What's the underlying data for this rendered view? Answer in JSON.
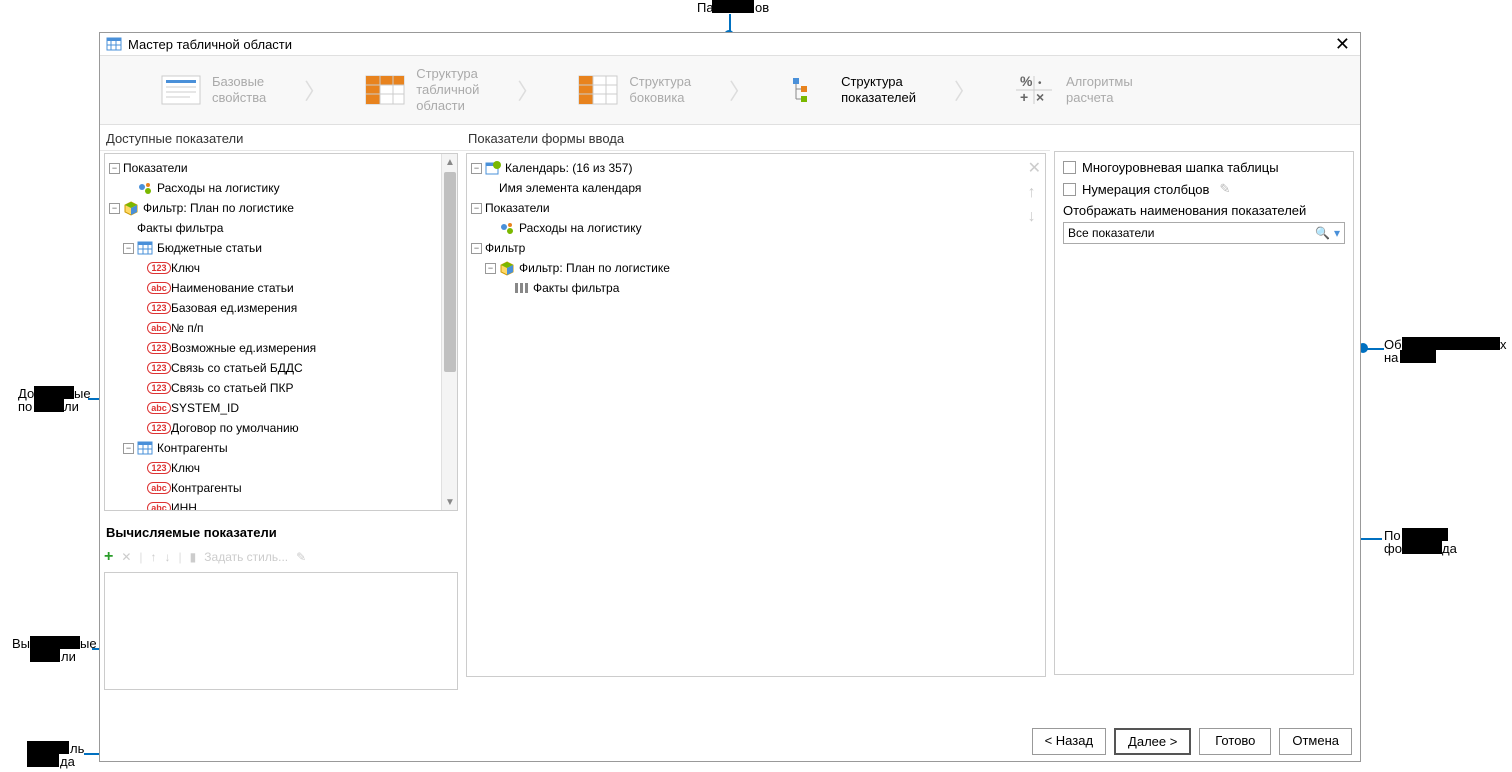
{
  "callouts": {
    "top": "Панель этапов",
    "left_avail": "Доступные\nпоказатели",
    "left_calc": "Вычисляемые\nпоказатели",
    "bottom_wizard": "Панель\nвизарда",
    "right_names": "Область общих\nнастроек",
    "right_form": "Показатели\nформы ввода"
  },
  "dialog": {
    "title": "Мастер табличной области"
  },
  "steps": [
    {
      "l1": "Базовые",
      "l2": "свойства"
    },
    {
      "l1": "Структура",
      "l2": "табличной",
      "l3": "области"
    },
    {
      "l1": "Структура",
      "l2": "боковика"
    },
    {
      "l1": "Структура",
      "l2": "показателей"
    },
    {
      "l1": "Алгоритмы",
      "l2": "расчета"
    }
  ],
  "left": {
    "header": "Доступные показатели",
    "tree": [
      {
        "lvl": 0,
        "toggle": "−",
        "icon": "none",
        "label": "Показатели"
      },
      {
        "lvl": 1,
        "toggle": "",
        "icon": "rec",
        "label": "Расходы на логистику"
      },
      {
        "lvl": 0,
        "toggle": "−",
        "icon": "cube",
        "label": "Фильтр: План по логистике"
      },
      {
        "lvl": 1,
        "toggle": "",
        "icon": "none",
        "label": "Факты фильтра"
      },
      {
        "lvl": 1,
        "toggle": "−",
        "icon": "grid",
        "label": "Бюджетные статьи"
      },
      {
        "lvl": 2,
        "toggle": "",
        "icon": "123",
        "label": "Ключ"
      },
      {
        "lvl": 2,
        "toggle": "",
        "icon": "abc",
        "label": "Наименование статьи"
      },
      {
        "lvl": 2,
        "toggle": "",
        "icon": "123",
        "label": "Базовая ед.измерения"
      },
      {
        "lvl": 2,
        "toggle": "",
        "icon": "abc",
        "label": "№ п/п"
      },
      {
        "lvl": 2,
        "toggle": "",
        "icon": "123",
        "label": "Возможные ед.измерения"
      },
      {
        "lvl": 2,
        "toggle": "",
        "icon": "123",
        "label": "Связь со статьей БДДС"
      },
      {
        "lvl": 2,
        "toggle": "",
        "icon": "123",
        "label": "Связь со статьей ПКР"
      },
      {
        "lvl": 2,
        "toggle": "",
        "icon": "abc",
        "label": "SYSTEM_ID"
      },
      {
        "lvl": 2,
        "toggle": "",
        "icon": "123",
        "label": "Договор по умолчанию"
      },
      {
        "lvl": 1,
        "toggle": "−",
        "icon": "grid",
        "label": "Контрагенты"
      },
      {
        "lvl": 2,
        "toggle": "",
        "icon": "123",
        "label": "Ключ"
      },
      {
        "lvl": 2,
        "toggle": "",
        "icon": "abc",
        "label": "Контрагенты"
      },
      {
        "lvl": 2,
        "toggle": "",
        "icon": "abc",
        "label": "ИНН"
      }
    ],
    "calc_header": "Вычисляемые показатели",
    "calc_style_label": "Задать стиль..."
  },
  "mid": {
    "header": "Показатели формы ввода",
    "tree": [
      {
        "lvl": 0,
        "toggle": "−",
        "icon": "cal",
        "label": "Календарь: (16 из 357)"
      },
      {
        "lvl": 1,
        "toggle": "",
        "icon": "none",
        "label": "Имя элемента календаря"
      },
      {
        "lvl": 0,
        "toggle": "−",
        "icon": "none",
        "label": "Показатели"
      },
      {
        "lvl": 1,
        "toggle": "",
        "icon": "rec",
        "label": "Расходы на логистику"
      },
      {
        "lvl": 0,
        "toggle": "−",
        "icon": "none",
        "label": "Фильтр"
      },
      {
        "lvl": 1,
        "toggle": "−",
        "icon": "cube",
        "label": "Фильтр: План по логистике"
      },
      {
        "lvl": 2,
        "toggle": "",
        "icon": "rows",
        "label": "Факты фильтра"
      }
    ]
  },
  "right": {
    "cb1": "Многоуровневая шапка таблицы",
    "cb2": "Нумерация столбцов",
    "label": "Отображать наименования показателей",
    "dropdown": "Все показатели"
  },
  "footer": {
    "back": "< Назад",
    "next": "Далее >",
    "finish": "Готово",
    "cancel": "Отмена"
  }
}
